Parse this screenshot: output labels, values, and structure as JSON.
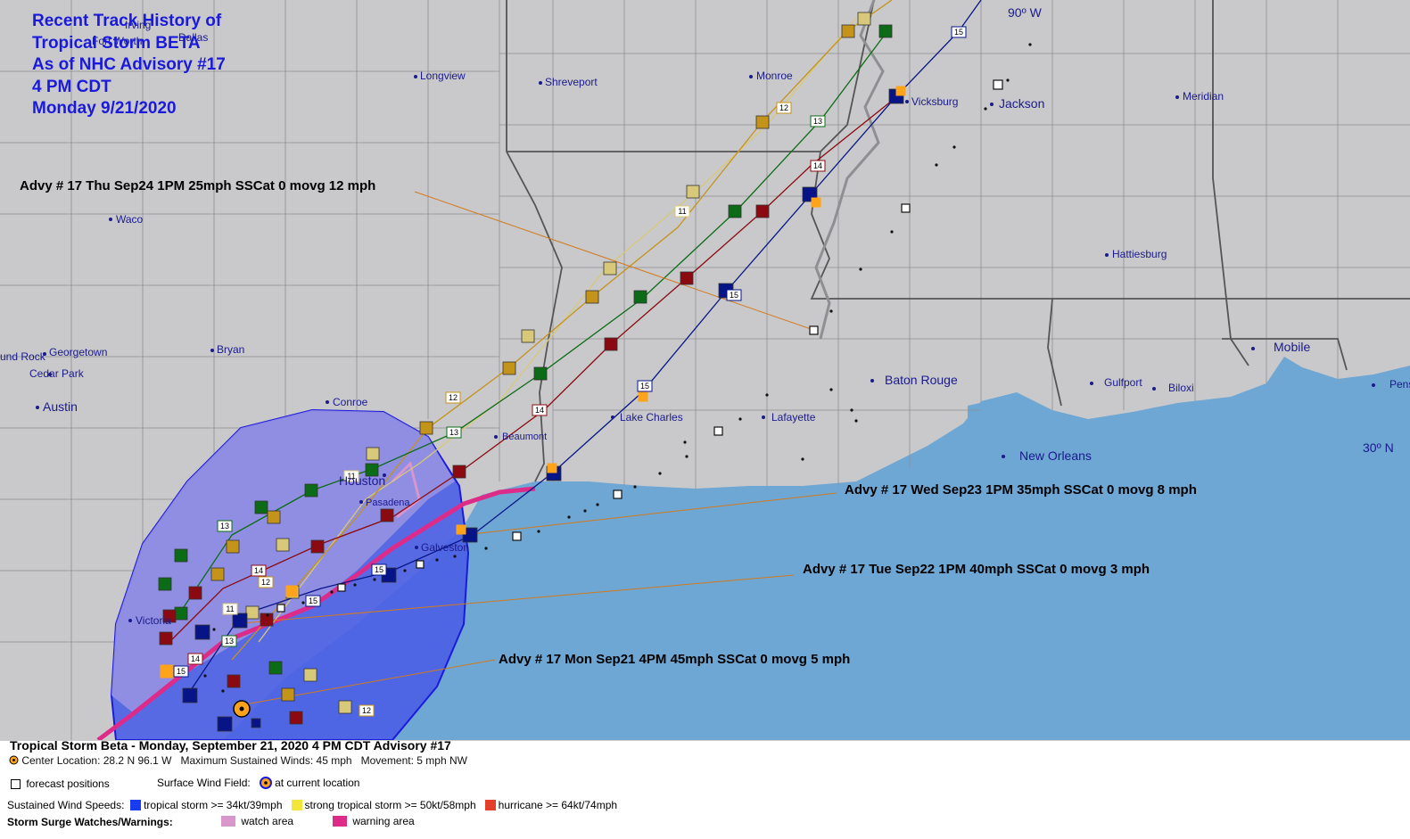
{
  "title": {
    "line1": "Recent Track History of",
    "line2": "Tropical Storm BETA",
    "line3": "As of NHC Advisory #17",
    "line4": "4 PM CDT",
    "line5": "Monday 9/21/2020"
  },
  "cities": {
    "dallas": "Dallas",
    "fort_worth": "Fort Worth",
    "irving": "Irving",
    "longview": "Longview",
    "shreveport": "Shreveport",
    "monroe": "Monroe",
    "vicksburg": "Vicksburg",
    "jackson": "Jackson",
    "meridian": "Meridian",
    "waco": "Waco",
    "hattiesburg": "Hattiesburg",
    "round_rock": "und Rock",
    "georgetown": "Georgetown",
    "cedar_park": "Cedar Park",
    "bryan": "Bryan",
    "austin": "Austin",
    "conroe": "Conroe",
    "houston": "Houston",
    "pasadena": "Pasadena",
    "galveston": "Galveston",
    "victoria": "Victoria",
    "beaumont": "Beaumont",
    "lake_charles": "Lake Charles",
    "lafayette": "Lafayette",
    "baton_rouge": "Baton Rouge",
    "new_orleans": "New Orleans",
    "gulfport": "Gulfport",
    "biloxi": "Biloxi",
    "mobile": "Mobile",
    "pensacola": "Pens"
  },
  "gridlabels": {
    "lon90": "90º W",
    "lat30": "30º N"
  },
  "annotations": {
    "thu": "Advy # 17 Thu Sep24 1PM  25mph SSCat 0 movg 12 mph",
    "wed": "Advy # 17 Wed Sep23 1PM  35mph SSCat 0 movg 8 mph",
    "tue": "Advy # 17 Tue Sep22 1PM  40mph SSCat 0 movg 3 mph",
    "mon": "Advy # 17 Mon Sep21 4PM  45mph SSCat 0 movg 5 mph"
  },
  "advisory_labels": [
    "11",
    "12",
    "13",
    "14",
    "15"
  ],
  "legend": {
    "headline": "Tropical Storm Beta  -  Monday, September 21, 2020  4 PM CDT   Advisory #17",
    "center_prefix": "Center Location:",
    "center_value": "28.2 N  96.1 W",
    "winds_prefix": "Maximum Sustained Winds:",
    "winds_value": "45 mph",
    "movement_prefix": "Movement:",
    "movement_value": "5 mph NW",
    "forecast_positions": "forecast positions",
    "surface_wind_field": "Surface Wind Field:",
    "at_current_location": "at current location",
    "sustained_wind_speeds": "Sustained Wind Speeds:",
    "tropical_storm": "tropical storm >= 34kt/39mph",
    "strong_tropical_storm": "strong tropical storm >= 50kt/58mph",
    "hurricane": "hurricane >= 64kt/74mph",
    "storm_surge": "Storm Surge Watches/Warnings:",
    "watch_area": "watch area",
    "warning_area": "warning area"
  },
  "colors": {
    "land": "#c9c9cb",
    "water": "#6ea6d4",
    "wind_field": "#4b5fe6",
    "wind_field_land": "#8a86e0",
    "title_blue": "#1a1adc",
    "track_11": "#d8c879",
    "track_12": "#c4931a",
    "track_13": "#0c6b16",
    "track_14": "#8b0a12",
    "track_15": "#061487",
    "surge_warning": "#dd2b8a",
    "surge_watch": "#d896cc"
  }
}
